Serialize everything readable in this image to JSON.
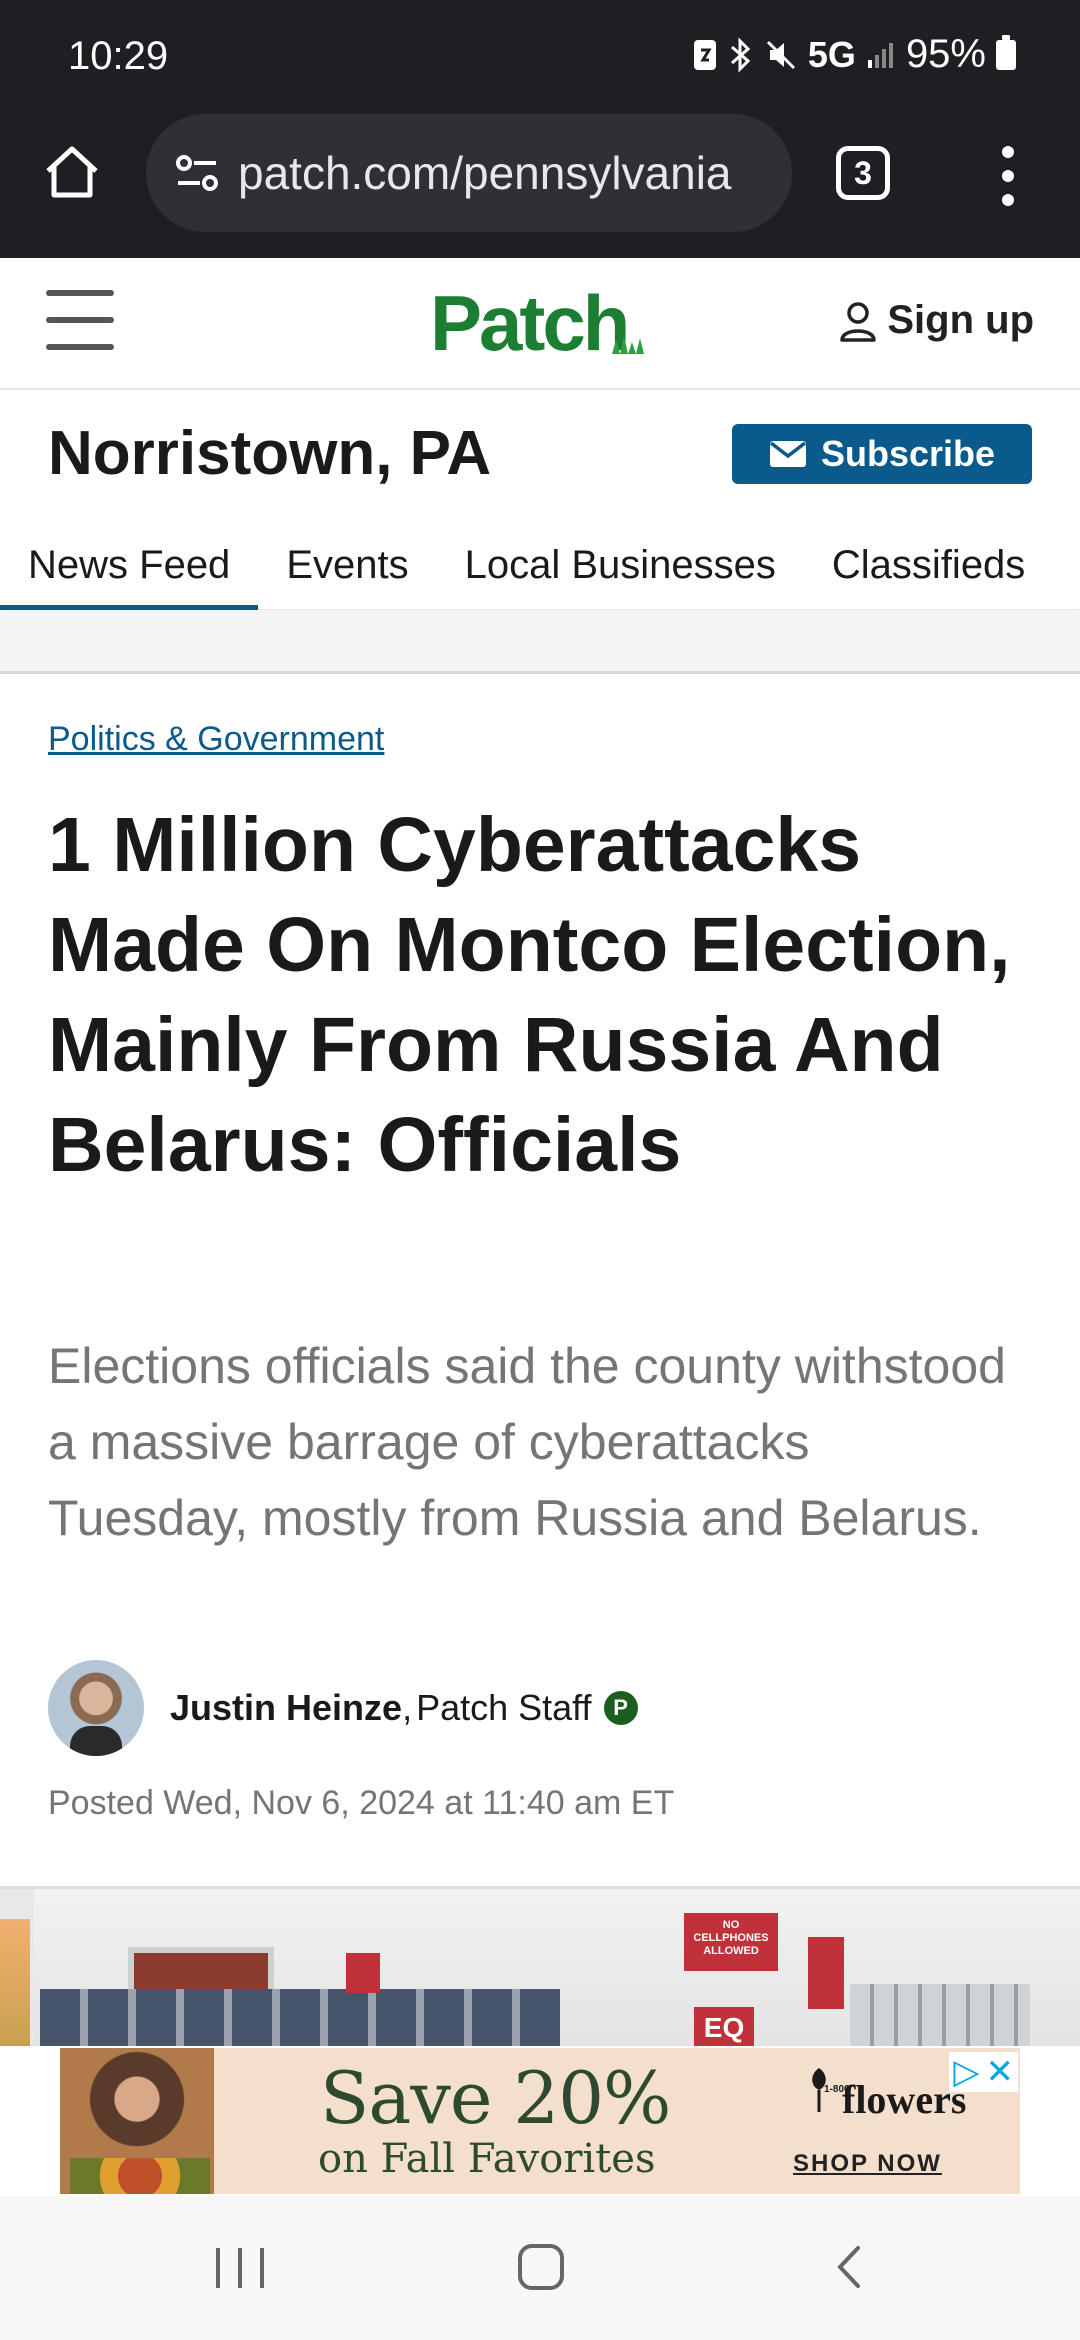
{
  "status_bar": {
    "time": "10:29",
    "network": "5G",
    "battery": "95%"
  },
  "browser": {
    "url": "patch.com/pennsylvania",
    "tab_count": "3"
  },
  "site_header": {
    "logo": "Patch",
    "sign_up_label": "Sign up"
  },
  "location": {
    "title": "Norristown, PA",
    "subscribe_label": "Subscribe"
  },
  "nav_tabs": [
    {
      "label": "News Feed",
      "active": true
    },
    {
      "label": "Events",
      "active": false
    },
    {
      "label": "Local Businesses",
      "active": false
    },
    {
      "label": "Classifieds",
      "active": false
    }
  ],
  "article": {
    "category": "Politics & Government",
    "headline": "1 Million Cyberattacks Made On Montco Election, Mainly From Russia And Belarus: Officials",
    "dek": "Elections officials said the county withstood a massive barrage of cyberattacks Tuesday, mostly from Russia and Belarus.",
    "author_name": "Justin Heinze",
    "author_role": "Patch Staff",
    "author_badge": "P",
    "posted": "Posted Wed, Nov 6, 2024 at 11:40 am ET",
    "image_sign_1": "NO CELLPHONES ALLOWED",
    "image_sign_2": "EQ"
  },
  "ad": {
    "headline": "Save 20%",
    "subline": "on Fall Favorites",
    "brand": "flowers",
    "brand_prefix": "1-800",
    "cta": "SHOP NOW"
  },
  "colors": {
    "brand_green": "#1b7e32",
    "link_blue": "#0b5a8c",
    "dark_bar": "#1e1f23"
  }
}
